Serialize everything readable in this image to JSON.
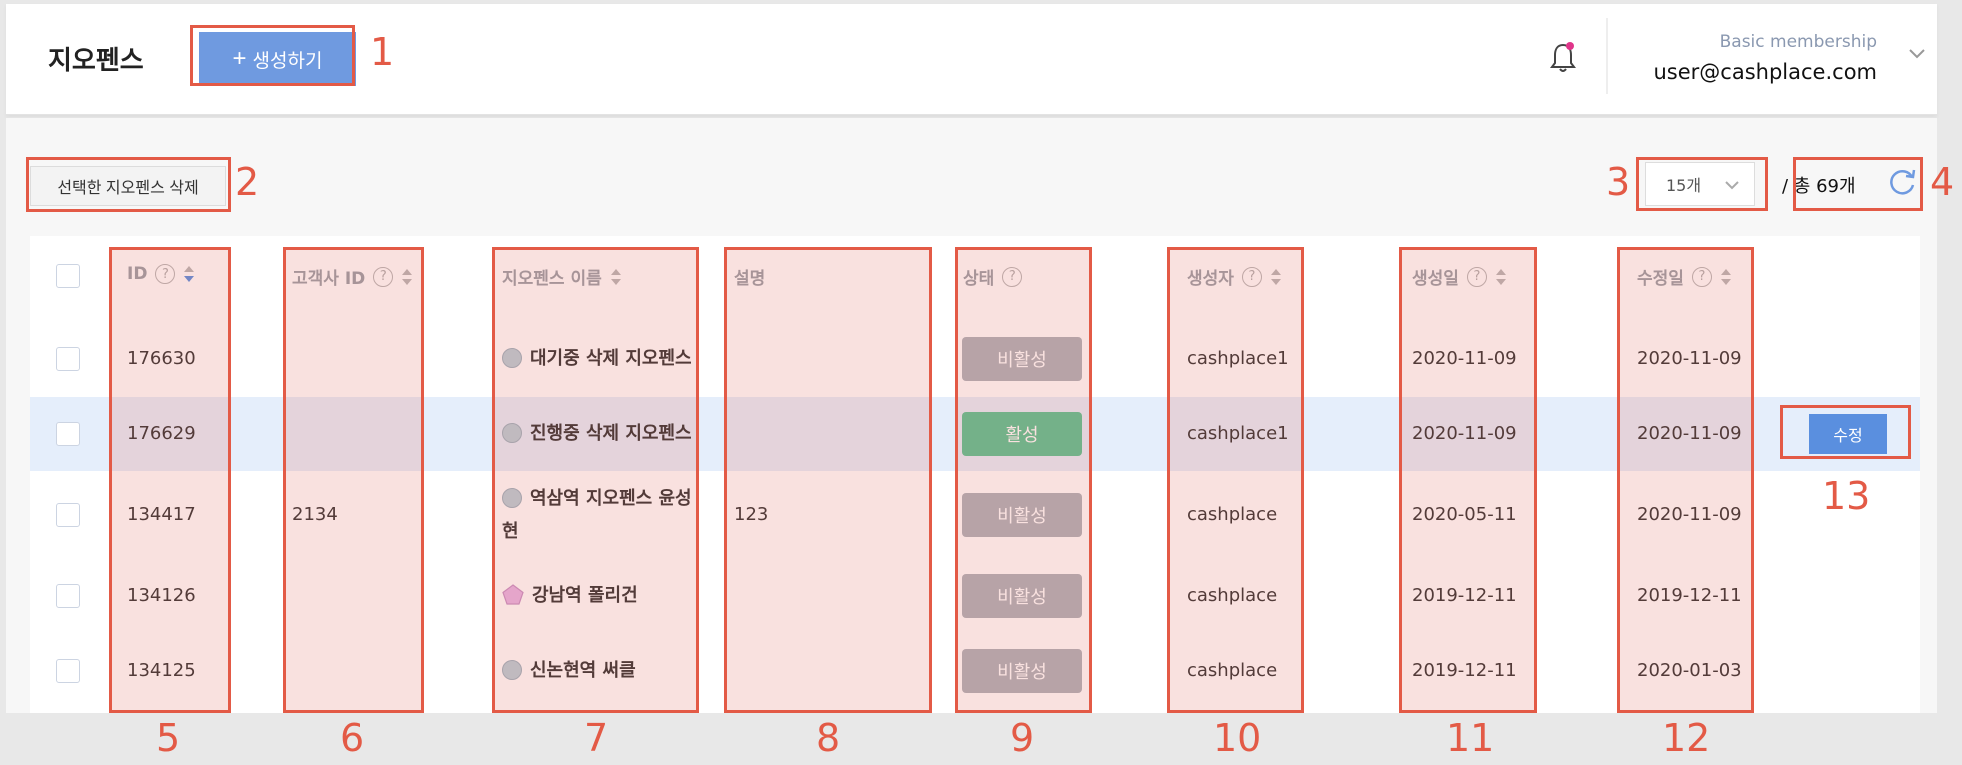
{
  "header": {
    "title": "지오펜스",
    "create_button": "생성하기",
    "membership": "Basic membership",
    "user_email": "user@cashplace.com"
  },
  "toolbar": {
    "delete_selected": "선택한 지오펜스 삭제",
    "page_size": "15개",
    "total": "/ 총 69개"
  },
  "table": {
    "columns": {
      "id": "ID",
      "client_id": "고객사 ID",
      "name": "지오펜스 이름",
      "description": "설명",
      "status": "상태",
      "creator": "생성자",
      "created": "생성일",
      "modified": "수정일"
    },
    "help_glyph": "?",
    "edit_label": "수정",
    "rows": [
      {
        "id": "176630",
        "client_id": "",
        "name": "대기중 삭제 지오펜스",
        "shape": "circle",
        "description": "",
        "status": "비활성",
        "creator": "cashplace1",
        "created": "2020-11-09",
        "modified": "2020-11-09"
      },
      {
        "id": "176629",
        "client_id": "",
        "name": "진행중 삭제 지오펜스",
        "shape": "circle",
        "description": "",
        "status": "활성",
        "creator": "cashplace1",
        "created": "2020-11-09",
        "modified": "2020-11-09"
      },
      {
        "id": "134417",
        "client_id": "2134",
        "name": "역삼역 지오펜스 윤성현",
        "shape": "circle",
        "description": "123",
        "status": "비활성",
        "creator": "cashplace",
        "created": "2020-05-11",
        "modified": "2020-11-09"
      },
      {
        "id": "134126",
        "client_id": "",
        "name": "강남역 폴리건",
        "shape": "polygon",
        "description": "",
        "status": "비활성",
        "creator": "cashplace",
        "created": "2019-12-11",
        "modified": "2019-12-11"
      },
      {
        "id": "134125",
        "client_id": "",
        "name": "신논현역 써클",
        "shape": "circle",
        "description": "",
        "status": "비활성",
        "creator": "cashplace",
        "created": "2019-12-11",
        "modified": "2020-01-03"
      }
    ]
  },
  "annotations": [
    "1",
    "2",
    "3",
    "4",
    "5",
    "6",
    "7",
    "8",
    "9",
    "10",
    "11",
    "12",
    "13"
  ],
  "colors": {
    "accent": "#6f9ae0",
    "annotation": "#e35a46",
    "active": "#5cc495",
    "inactive": "#aeb3bb"
  }
}
